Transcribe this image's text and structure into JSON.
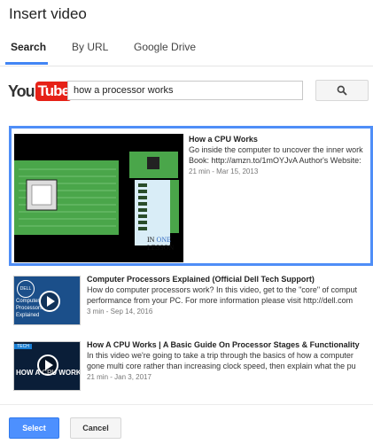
{
  "dialog": {
    "title": "Insert video"
  },
  "tabs": [
    {
      "label": "Search"
    },
    {
      "label": "By URL"
    },
    {
      "label": "Google Drive"
    }
  ],
  "search": {
    "logo_you": "You",
    "logo_tube": "Tube",
    "query": "how a processor works",
    "button_icon": "search-icon"
  },
  "results": [
    {
      "title": "How a CPU Works",
      "desc1": "Go inside the computer to uncover the inner work",
      "desc2": "Book: http://amzn.to/1mOYJvA Author's Website:",
      "info": "21 min - Mar 15, 2013",
      "thumb_text": "IN ONE LESSON",
      "selected": true
    },
    {
      "title": "Computer Processors Explained (Official Dell Tech Support)",
      "desc1": "How do computer processors work? In this video, get to the \"core\" of comput",
      "desc2": "performance from your PC. For more information please visit http://dell.com",
      "info": "3 min - Sep 14, 2016",
      "thumb_text": "Computer Processors Explained",
      "selected": false
    },
    {
      "title": "How A CPU Works | A Basic Guide On Processor Stages & Functionality",
      "desc1": "In this video we're going to take a trip through the basics of how a computer",
      "desc2": "gone multi core rather than increasing clock speed, then explain what the pu",
      "info": "21 min - Jan 3, 2017",
      "thumb_text": "HOW A CPU WORKS",
      "selected": false
    }
  ],
  "footer": {
    "select_label": "Select",
    "cancel_label": "Cancel"
  },
  "colors": {
    "accent": "#4285f4",
    "selection": "#4f8ef7",
    "youtube_red": "#e62117",
    "select_button": "#4d90fe"
  }
}
